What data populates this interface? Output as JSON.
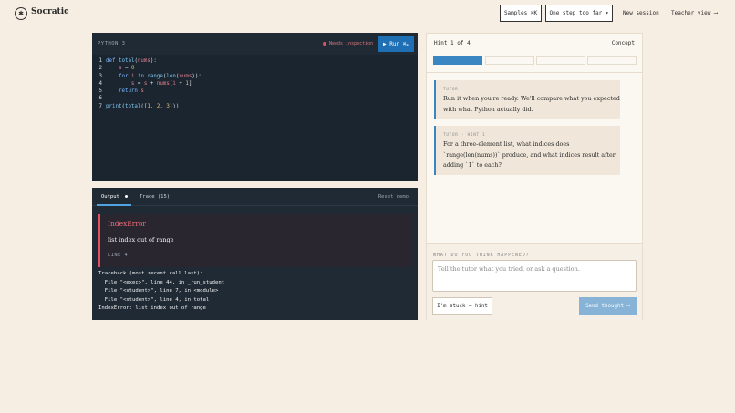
{
  "header": {
    "logo_glyph": "✱",
    "app_name": "Socratic",
    "samples_label": "Samples ⌘K",
    "mode_label": "One step too far ▾",
    "new_session_label": "New session",
    "teacher_view_label": "Teacher view ⟶"
  },
  "editor": {
    "language": "PYTHON 3",
    "status": "Needs inspection",
    "run_label": "▶ Run ⌘↵",
    "lines": [
      {
        "n": "1"
      },
      {
        "n": "2"
      },
      {
        "n": "3"
      },
      {
        "n": "4"
      },
      {
        "n": "5"
      },
      {
        "n": "6"
      },
      {
        "n": "7"
      }
    ]
  },
  "output": {
    "tab_output": "Output",
    "tab_trace": "Trace (15)",
    "reset_label": "Reset demo",
    "error_type": "IndexError",
    "error_message": "list index out of range",
    "error_line": "LINE 4",
    "traceback": "Traceback (most recent call last):\n  File \"<exec>\", line 44, in _run_student\n  File \"<student>\", line 7, in <module>\n  File \"<student>\", line 4, in total\nIndexError: list index out of range"
  },
  "tutor": {
    "hint_label": "Hint 1 of 4",
    "concept_label": "Concept",
    "hint_progress": 1,
    "hint_total": 4,
    "messages": [
      {
        "head": "TUTOR",
        "body": "Run it when you're ready. We'll compare what you expected with what Python actually did."
      },
      {
        "head": "TUTOR · HINT 1",
        "body": "For a three-element list, what indices does `range(len(nums))` produce, and what indices result after adding `1` to each?"
      }
    ],
    "compose_label": "WHAT DO YOU THINK HAPPENED?",
    "compose_placeholder": "Tell the tutor what you tried, or ask a question.",
    "stuck_label": "I'm stuck — hint",
    "send_label": "Send thought ⟶"
  },
  "colors": {
    "accent": "#3a86c3",
    "editor_bg": "#1f2a35",
    "error": "#e05060",
    "page_bg": "#f6eee3"
  }
}
